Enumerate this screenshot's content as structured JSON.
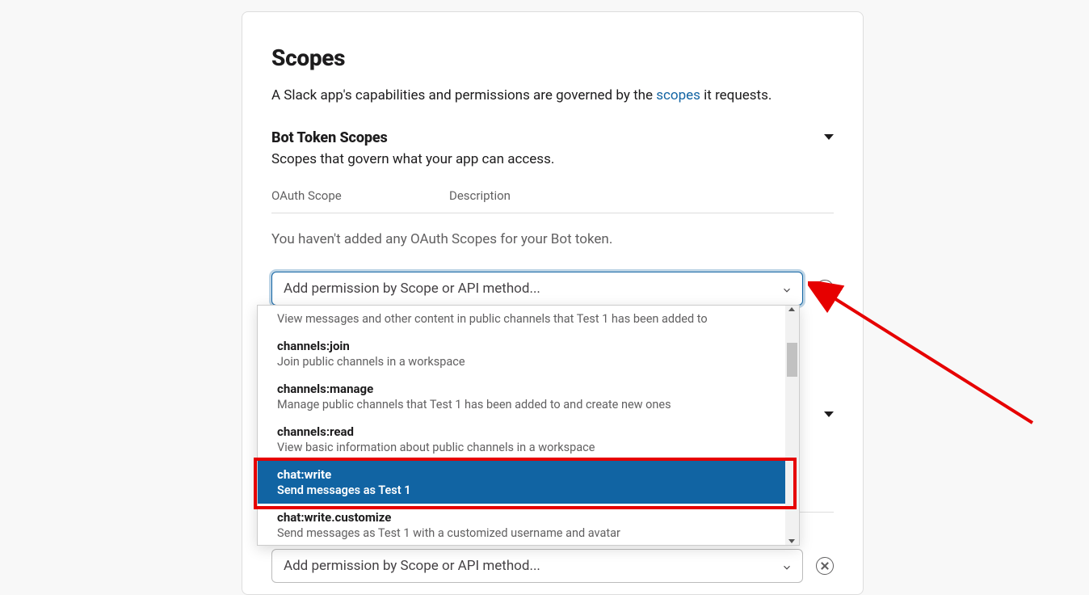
{
  "page": {
    "title": "Scopes",
    "desc_pre": "A Slack app's capabilities and permissions are governed by the ",
    "desc_link": "scopes",
    "desc_post": " it requests."
  },
  "bot_section": {
    "title": "Bot Token Scopes",
    "subtitle": "Scopes that govern what your app can access."
  },
  "table": {
    "col_scope": "OAuth Scope",
    "col_desc": "Description"
  },
  "empty_state": "You haven't added any OAuth Scopes for your Bot token.",
  "combo": {
    "placeholder": "Add permission by Scope or API method..."
  },
  "dropdown": {
    "partial_top_desc": "View messages and other content in public channels that Test 1 has been added to",
    "items": [
      {
        "name": "channels:join",
        "desc": "Join public channels in a workspace",
        "selected": false
      },
      {
        "name": "channels:manage",
        "desc": "Manage public channels that Test 1 has been added to and create new ones",
        "selected": false
      },
      {
        "name": "channels:read",
        "desc": "View basic information about public channels in a workspace",
        "selected": false
      },
      {
        "name": "chat:write",
        "desc": "Send messages as Test 1",
        "selected": true
      },
      {
        "name": "chat:write.customize",
        "desc": "Send messages as Test 1 with a customized username and avatar",
        "selected": false
      }
    ]
  }
}
